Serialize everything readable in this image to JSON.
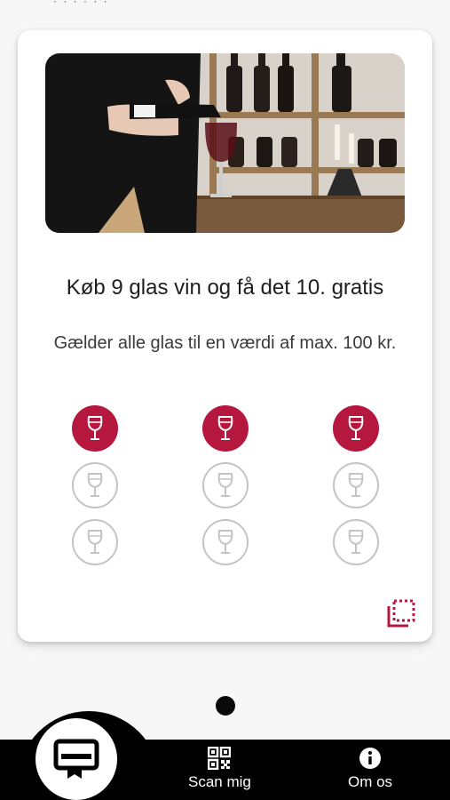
{
  "card": {
    "title": "Køb 9 glas vin og få det 10. gratis",
    "description": "Gælder alle glas til en værdi af max. 100 kr.",
    "stamps": {
      "total": 9,
      "collected": 3
    }
  },
  "colors": {
    "accent": "#b5173f",
    "empty_stamp_border": "#c4c4c4",
    "nav_background": "#000000"
  },
  "icons": {
    "stamp": "wine-glass-icon",
    "card_corner": "scan-corner-icon",
    "nav_cards": "loyalty-card-icon",
    "nav_scan": "qr-code-icon",
    "nav_about": "info-icon"
  },
  "pager": {
    "current": 1,
    "total": 1
  },
  "nav": {
    "scan_label": "Scan mig",
    "about_label": "Om os"
  }
}
